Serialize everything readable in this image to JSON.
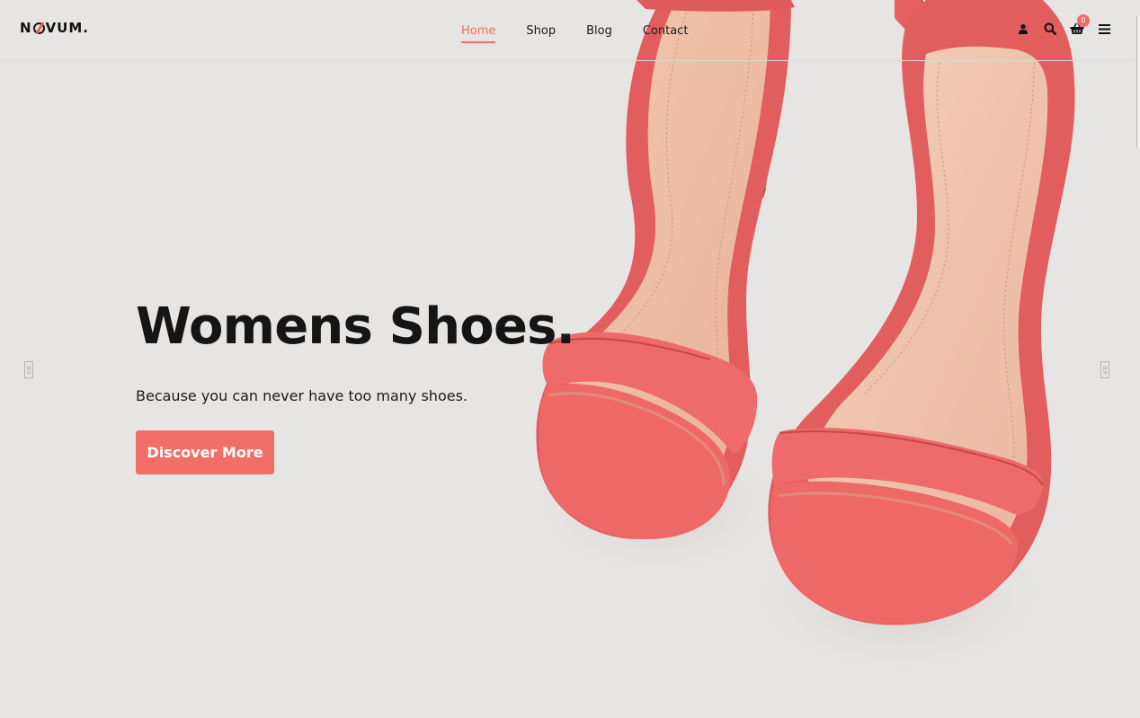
{
  "brand": {
    "logo_text_left": "N",
    "logo_text_right": "VUM."
  },
  "nav": {
    "items": [
      {
        "label": "Home",
        "active": true
      },
      {
        "label": "Shop",
        "active": false
      },
      {
        "label": "Blog",
        "active": false
      },
      {
        "label": "Contact",
        "active": false
      }
    ]
  },
  "header_icons": {
    "account": "user-icon",
    "search": "search-icon",
    "cart": "basket-icon",
    "cart_count": "0",
    "menu": "hamburger-icon"
  },
  "hero": {
    "title": "Womens Shoes.",
    "subtitle": "Because you can never have too many shoes.",
    "cta_label": "Discover More"
  },
  "slider": {
    "prev_label": "E0 53",
    "next_label": "E0 54"
  },
  "colors": {
    "accent": "#f26f68",
    "background": "#e7e5e3",
    "text": "#151515",
    "shoe": "#e8605f"
  }
}
